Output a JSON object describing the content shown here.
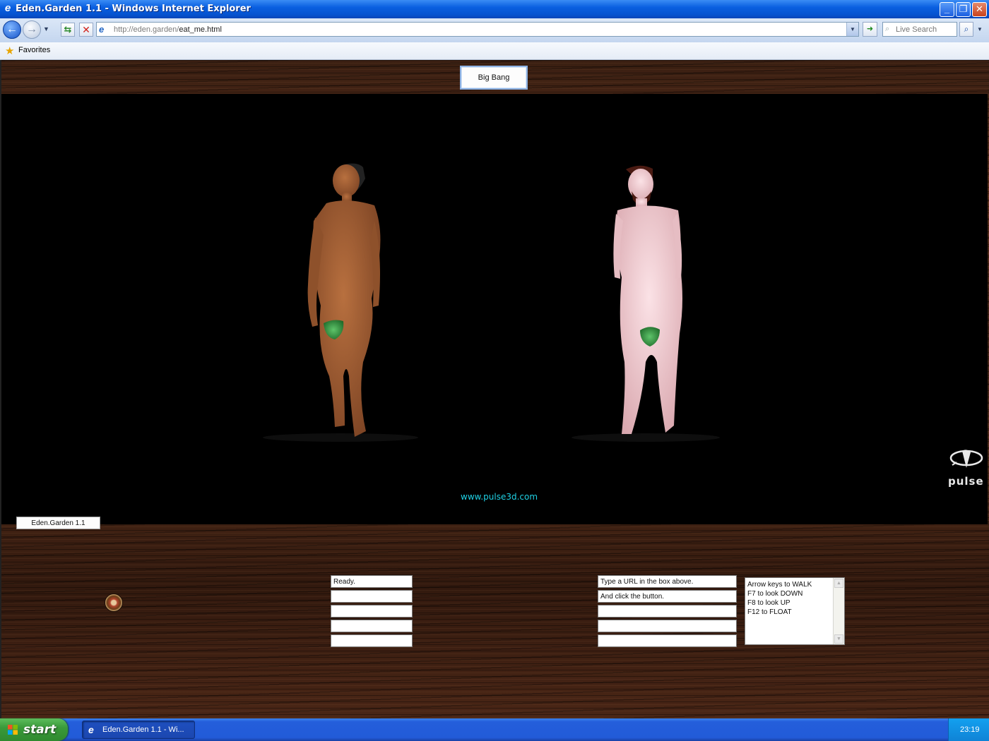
{
  "window": {
    "title": "Eden.Garden 1.1 - Windows Internet Explorer",
    "icon": "ie-logo-icon",
    "controls": [
      "minimize",
      "restore",
      "close"
    ]
  },
  "navbar": {
    "url_host": "http://eden.garden/",
    "url_path": "eat_me.html",
    "search_placeholder": "Live Search"
  },
  "favorites": {
    "label": "Favorites"
  },
  "page": {
    "big_bang_button": "Big Bang",
    "site_link": "www.pulse3d.com",
    "pulse_logo": "pulse",
    "eden_button": "Eden.Garden 1.1",
    "status_fields": [
      "Ready.",
      "",
      "",
      "",
      ""
    ],
    "message_fields": [
      "Type a URL in the box above.",
      "And click the button.",
      "",
      "",
      ""
    ],
    "help_lines": [
      "Arrow keys to WALK",
      "F7 to look DOWN",
      "F8 to look UP",
      "F12 to FLOAT"
    ]
  },
  "taskbar": {
    "start_label": "start",
    "task_label": "Eden.Garden 1.1 - Wi...",
    "clock": "23:19"
  }
}
